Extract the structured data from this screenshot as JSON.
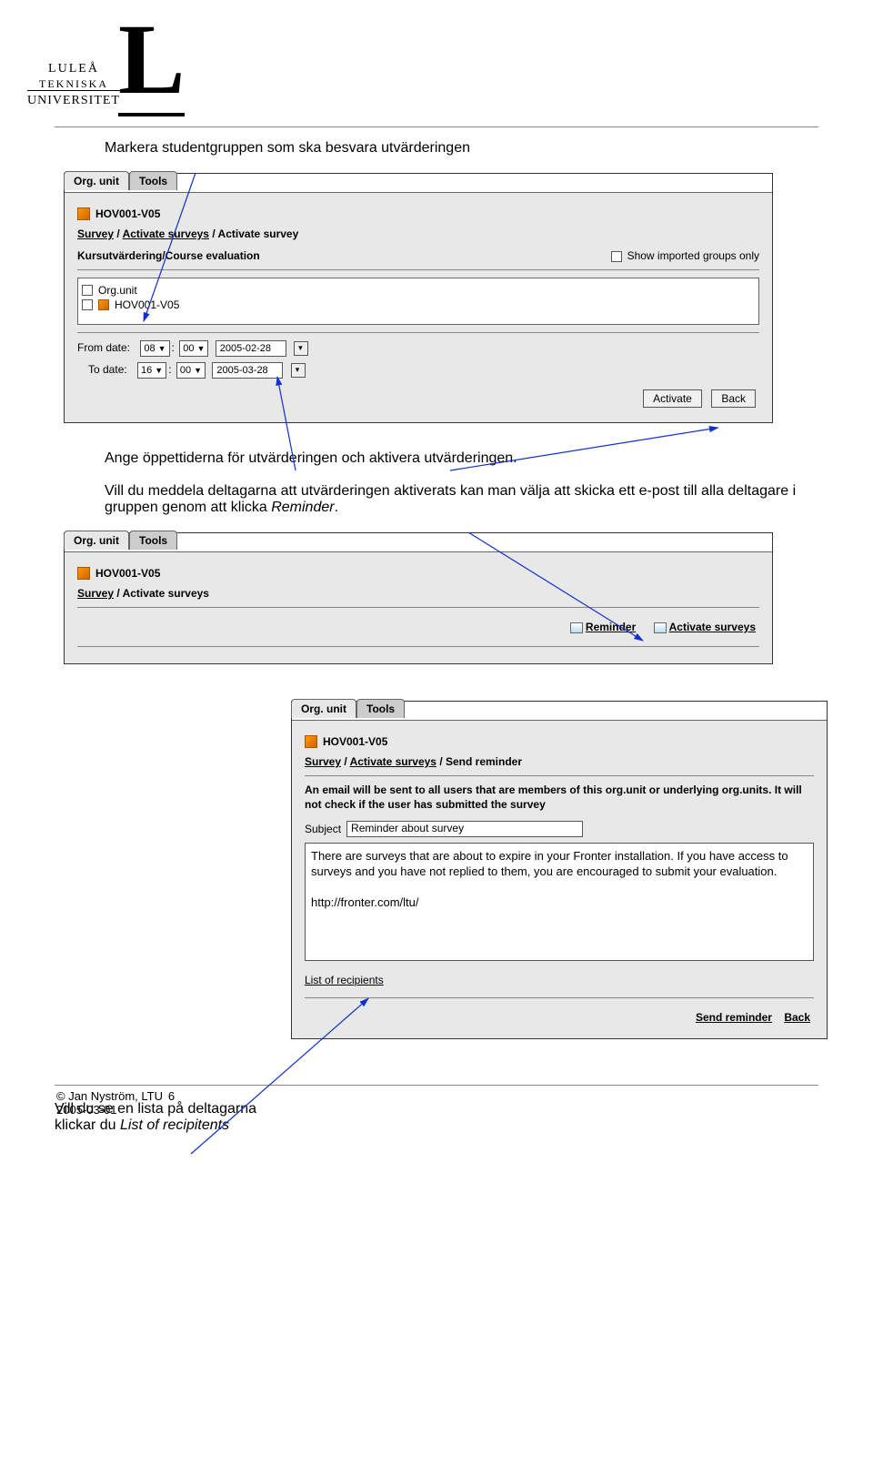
{
  "logo": {
    "line1": "LULEÅ",
    "line2": "TEKNISKA",
    "line3": "UNIVERSITET"
  },
  "instr1": "Markera studentgruppen som ska besvara utvärderingen",
  "instr2a": "Ange öppettiderna för utvärderingen och aktivera utvärderingen.",
  "instr2b_pre": "Vill du meddela deltagarna att utvärderingen aktiverats kan man välja att skicka ett e-post till alla deltagare i gruppen genom att klicka ",
  "instr2b_it": "Reminder",
  "tabs": {
    "org": "Org. unit",
    "tools": "Tools"
  },
  "common": {
    "course": "HOV001-V05"
  },
  "p1": {
    "crumb1": "Survey",
    "crumb2": "Activate surveys",
    "crumb3": "Activate survey",
    "title": "Kursutvärdering/Course evaluation",
    "show_imported": "Show imported groups only",
    "list_hdr": "Org.unit",
    "list_item": "HOV001-V05",
    "from": "From date:",
    "to": "To date:",
    "h1": "08",
    "m1": "00",
    "d1": "2005-02-28",
    "h2": "16",
    "m2": "00",
    "d2": "2005-03-28",
    "btn_activate": "Activate",
    "btn_back": "Back"
  },
  "p2": {
    "crumb1": "Survey",
    "crumb2": "Activate surveys",
    "link_reminder": "Reminder",
    "link_activate": "Activate surveys"
  },
  "sidecap": {
    "pre": "Vill du se en lista på deltagarna klickar du ",
    "it": "List of recipitents"
  },
  "p3": {
    "crumb1": "Survey",
    "crumb2": "Activate surveys",
    "crumb3": "Send reminder",
    "desc": "An email will be sent to all users that are members of this org.unit or underlying org.units. It will not check if the user has submitted the survey",
    "subject_lbl": "Subject",
    "subject_val": "Reminder about survey",
    "body": "There are surveys that are about to expire in your Fronter installation. If you have access to surveys and you have not replied to them, you are encouraged to submit your evaluation.\n\nhttp://fronter.com/ltu/",
    "recip": "List of recipients",
    "btn_send": "Send reminder",
    "btn_back": "Back"
  },
  "footer": {
    "author": "© Jan Nyström, LTU",
    "date": "2005-03-01",
    "page": "6"
  }
}
